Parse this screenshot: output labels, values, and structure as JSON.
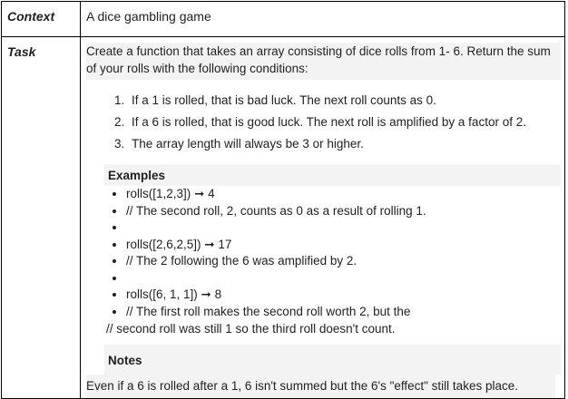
{
  "context": {
    "label": "Context",
    "value": "A dice gambling game"
  },
  "task": {
    "label": "Task",
    "intro": "Create a function that takes an array consisting of dice rolls from 1- 6. Return the sum of your rolls with the following conditions:",
    "conditions": [
      "If a 1 is rolled, that is bad luck. The next roll counts as 0.",
      "If a 6 is rolled, that is good luck. The next roll is amplified by a factor of 2.",
      "The array length will always be 3 or higher."
    ],
    "examples_heading": "Examples",
    "examples": [
      "rolls([1,2,3]) ➞ 4",
      "// The second roll, 2, counts as 0 as a result of rolling 1.",
      "",
      "rolls([2,6,2,5]) ➞ 17",
      "// The 2 following the 6 was amplified by 2.",
      "",
      "rolls([6, 1, 1]) ➞ 8",
      "// The first roll makes the second roll worth 2, but the"
    ],
    "examples_continuation": "// second roll was still 1 so the third roll doesn't count.",
    "notes_heading": "Notes",
    "notes_text": "Even if a 6 is rolled after a 1, 6 isn't summed but the 6's \"effect\" still takes place."
  }
}
